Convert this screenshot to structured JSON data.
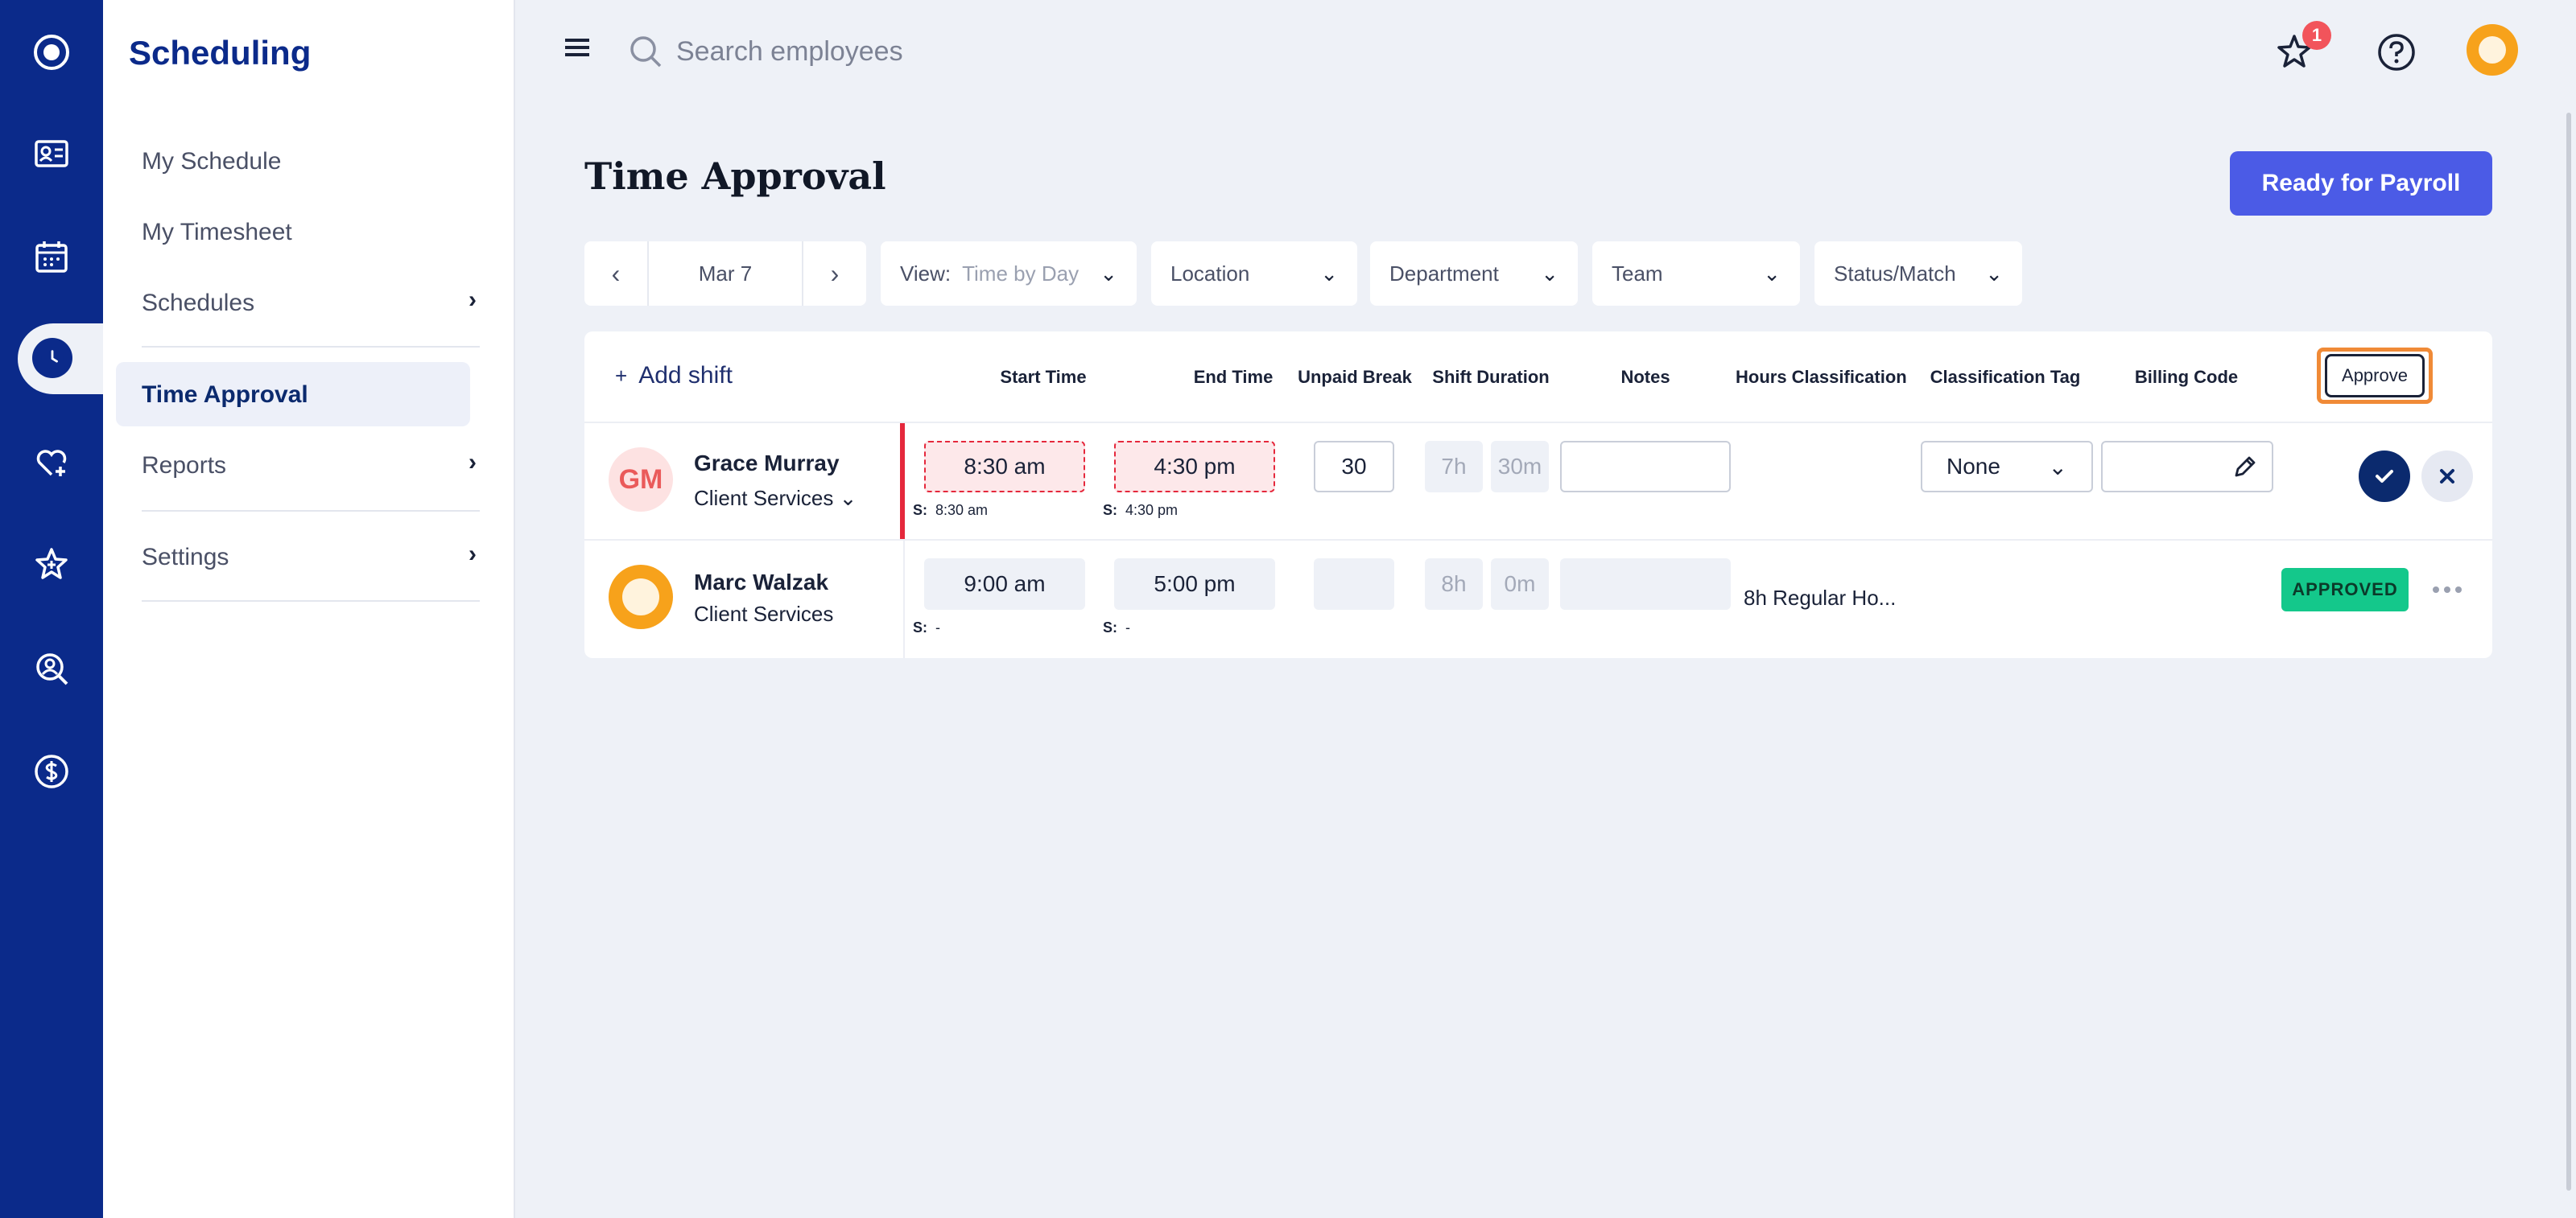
{
  "sidebar": {
    "title": "Scheduling",
    "items": [
      {
        "label": "My Schedule"
      },
      {
        "label": "My Timesheet"
      },
      {
        "label": "Schedules"
      },
      {
        "label": "Time Approval"
      },
      {
        "label": "Reports"
      },
      {
        "label": "Settings"
      }
    ]
  },
  "topbar": {
    "search_placeholder": "Search employees",
    "notification_count": "1"
  },
  "page": {
    "title": "Time Approval",
    "payroll_button": "Ready for Payroll"
  },
  "filters": {
    "date": "Mar 7",
    "view_label": "View:",
    "view_value": "Time by Day",
    "location": "Location",
    "department": "Department",
    "team": "Team",
    "status": "Status/Match"
  },
  "table": {
    "add_shift": "Add shift",
    "columns": {
      "start": "Start Time",
      "end": "End Time",
      "break": "Unpaid Break",
      "duration": "Shift Duration",
      "notes": "Notes",
      "hours_class": "Hours Classification",
      "class_tag": "Classification Tag",
      "billing": "Billing Code",
      "approve": "Approve"
    },
    "rows": [
      {
        "initials": "GM",
        "name": "Grace Murray",
        "dept": "Client Services",
        "start": "8:30 am",
        "end": "4:30 pm",
        "sched_prefix": "S:",
        "sched_start": "8:30 am",
        "sched_end": "4:30 pm",
        "break": "30",
        "dur_h": "7h",
        "dur_m": "30m",
        "tag": "None"
      },
      {
        "name": "Marc Walzak",
        "dept": "Client Services",
        "start": "9:00 am",
        "end": "5:00 pm",
        "sched_prefix": "S:",
        "sched_start": "-",
        "sched_end": "-",
        "dur_h": "8h",
        "dur_m": "0m",
        "hours_class": "8h Regular Ho...",
        "status": "APPROVED"
      }
    ]
  },
  "colors": {
    "rail": "#0b2a8a",
    "primary_button": "#4b5be6",
    "approved": "#14c88b",
    "warning": "#e5283c",
    "highlight": "#f08a37"
  }
}
